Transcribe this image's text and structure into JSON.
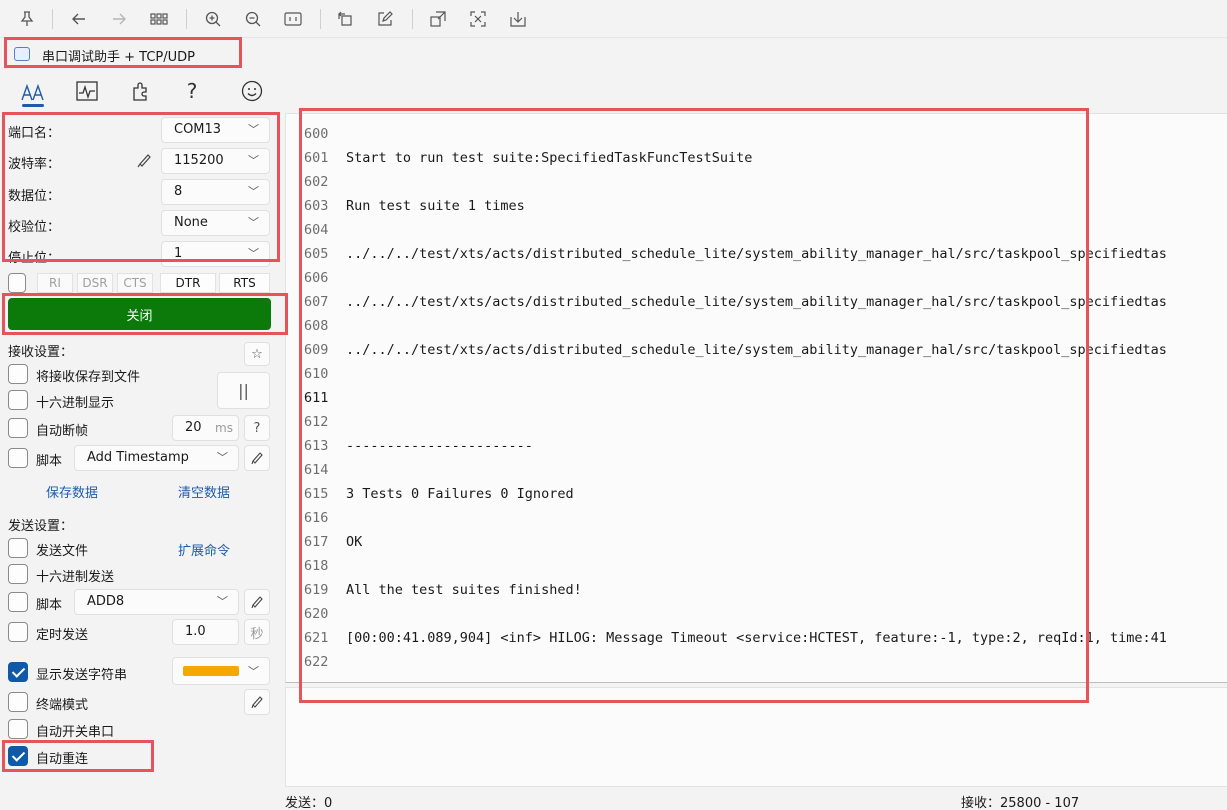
{
  "toolbar": {
    "icons": [
      "pin-icon",
      "back-arrow-icon",
      "forward-arrow-icon",
      "grid-icon",
      "zoom-in-icon",
      "zoom-out-icon",
      "fit-screen-icon",
      "rotate-icon",
      "edit-icon",
      "share-icon",
      "crop-icon",
      "download-icon"
    ]
  },
  "app": {
    "title": "串口调试助手 + TCP/UDP",
    "nav_icons": [
      "font-settings-icon",
      "chart-icon",
      "plugin-icon",
      "help-icon",
      "smiley-icon"
    ],
    "nav_help_glyph": "?"
  },
  "serial": {
    "port_label": "端口名：",
    "port_value": "COM13",
    "baud_label": "波特率：",
    "baud_value": "115200",
    "databits_label": "数据位：",
    "databits_value": "8",
    "parity_label": "校验位：",
    "parity_value": "None",
    "stopbits_label": "停止位：",
    "stopbits_value": "1",
    "signals": [
      "RI",
      "DSR",
      "CTS",
      "DTR",
      "RTS"
    ],
    "close_button": "关闭"
  },
  "receive": {
    "section_label": "接收设置：",
    "save_to_file": "将接收保存到文件",
    "hex_display": "十六进制显示",
    "auto_frame": "自动断帧",
    "frame_ms": "20",
    "frame_unit": "ms",
    "frame_help": "?",
    "script_label": "脚本",
    "script_value": "Add Timestamp",
    "save_data": "保存数据",
    "clear_data": "清空数据",
    "pause_glyph": "||",
    "star_glyph": "☆"
  },
  "send": {
    "section_label": "发送设置：",
    "send_file": "发送文件",
    "extend_cmd": "扩展命令",
    "hex_send": "十六进制发送",
    "script_label": "脚本",
    "script_value": "ADD8",
    "timed_send": "定时发送",
    "timed_value": "1.0",
    "timed_unit": "秒",
    "show_send_string": "显示发送字符串",
    "terminal_mode": "终端模式",
    "auto_toggle_port": "自动开关串口",
    "auto_reconnect": "自动重连",
    "accent_color": "#f5a800"
  },
  "output": {
    "lines": [
      {
        "n": "600",
        "t": ""
      },
      {
        "n": "601",
        "t": "Start to run test suite:SpecifiedTaskFuncTestSuite"
      },
      {
        "n": "602",
        "t": ""
      },
      {
        "n": "603",
        "t": "Run test suite 1 times"
      },
      {
        "n": "604",
        "t": ""
      },
      {
        "n": "605",
        "t": "../../../test/xts/acts/distributed_schedule_lite/system_ability_manager_hal/src/taskpool_specifiedtas"
      },
      {
        "n": "606",
        "t": ""
      },
      {
        "n": "607",
        "t": "../../../test/xts/acts/distributed_schedule_lite/system_ability_manager_hal/src/taskpool_specifiedtas"
      },
      {
        "n": "608",
        "t": ""
      },
      {
        "n": "609",
        "t": "../../../test/xts/acts/distributed_schedule_lite/system_ability_manager_hal/src/taskpool_specifiedtas"
      },
      {
        "n": "610",
        "t": ""
      },
      {
        "n": "611",
        "t": ""
      },
      {
        "n": "612",
        "t": ""
      },
      {
        "n": "613",
        "t": "-----------------------"
      },
      {
        "n": "614",
        "t": ""
      },
      {
        "n": "615",
        "t": "3 Tests 0 Failures 0 Ignored"
      },
      {
        "n": "616",
        "t": ""
      },
      {
        "n": "617",
        "t": "OK"
      },
      {
        "n": "618",
        "t": ""
      },
      {
        "n": "619",
        "t": "All the test suites finished!"
      },
      {
        "n": "620",
        "t": ""
      },
      {
        "n": "621",
        "t": "[00:00:41.089,904] <inf> HILOG: Message Timeout <service:HCTEST, feature:-1, type:2, reqId:1, time:41"
      },
      {
        "n": "622",
        "t": ""
      }
    ],
    "current_line": "611"
  },
  "status": {
    "send": "发送：0",
    "receive": "接收：25800 - 107"
  },
  "colors": {
    "highlight_box": "#e5545a",
    "close_button_bg": "#0b7a0b",
    "accent_blue": "#1e5ca8"
  }
}
